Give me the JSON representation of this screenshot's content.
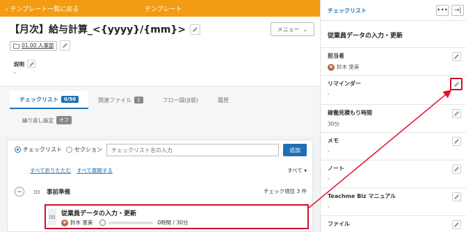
{
  "header": {
    "back_label": "テンプレート一覧に戻る",
    "center_label": "テンプレート"
  },
  "template": {
    "title": "【月次】給与計算_<{yyyy}/{mm}>",
    "menu_label": "メニュー",
    "folder": "01.00 人事部",
    "description_label": "説明",
    "description_value": "-"
  },
  "tabs": [
    {
      "label": "チェックリスト",
      "badge": "0/50"
    },
    {
      "label": "関連ファイル",
      "badge": "2"
    },
    {
      "label": "フロー図(β版)"
    },
    {
      "label": "履歴"
    }
  ],
  "repeat": {
    "label": "繰り返し設定",
    "state": "オフ"
  },
  "checklist_form": {
    "radio_checklist": "チェックリスト",
    "radio_section": "セクション",
    "input_placeholder": "チェックリスト名の入力",
    "add_label": "追加",
    "collapse_all": "すべて折りたたむ",
    "expand_all": "すべて展開する",
    "filter": "すべて ▾"
  },
  "section": {
    "name": "事前準備",
    "count": "チェック項目 3 件"
  },
  "item": {
    "name": "従業員データの入力・更新",
    "assignee": "鈴木 里美",
    "time": "0時間 / 30分"
  },
  "panel": {
    "title": "チェックリスト",
    "more_icon": "•••",
    "collapse_icon": "→|",
    "item_name": "従業員データの入力・更新",
    "sections": [
      {
        "label": "担当者",
        "value": "鈴木 里美"
      },
      {
        "label": "リマインダー",
        "value": "-"
      },
      {
        "label": "稼働見積もり時間",
        "value": "30分"
      },
      {
        "label": "メモ",
        "value": "-"
      },
      {
        "label": "ノート",
        "value": "-"
      },
      {
        "label": "Teachme Biz マニュアル",
        "value": "-"
      },
      {
        "label": "ファイル",
        "value": ""
      }
    ]
  },
  "colors": {
    "accent": "#f39c12",
    "primary": "#1f6fb2",
    "highlight": "#c8102e"
  }
}
